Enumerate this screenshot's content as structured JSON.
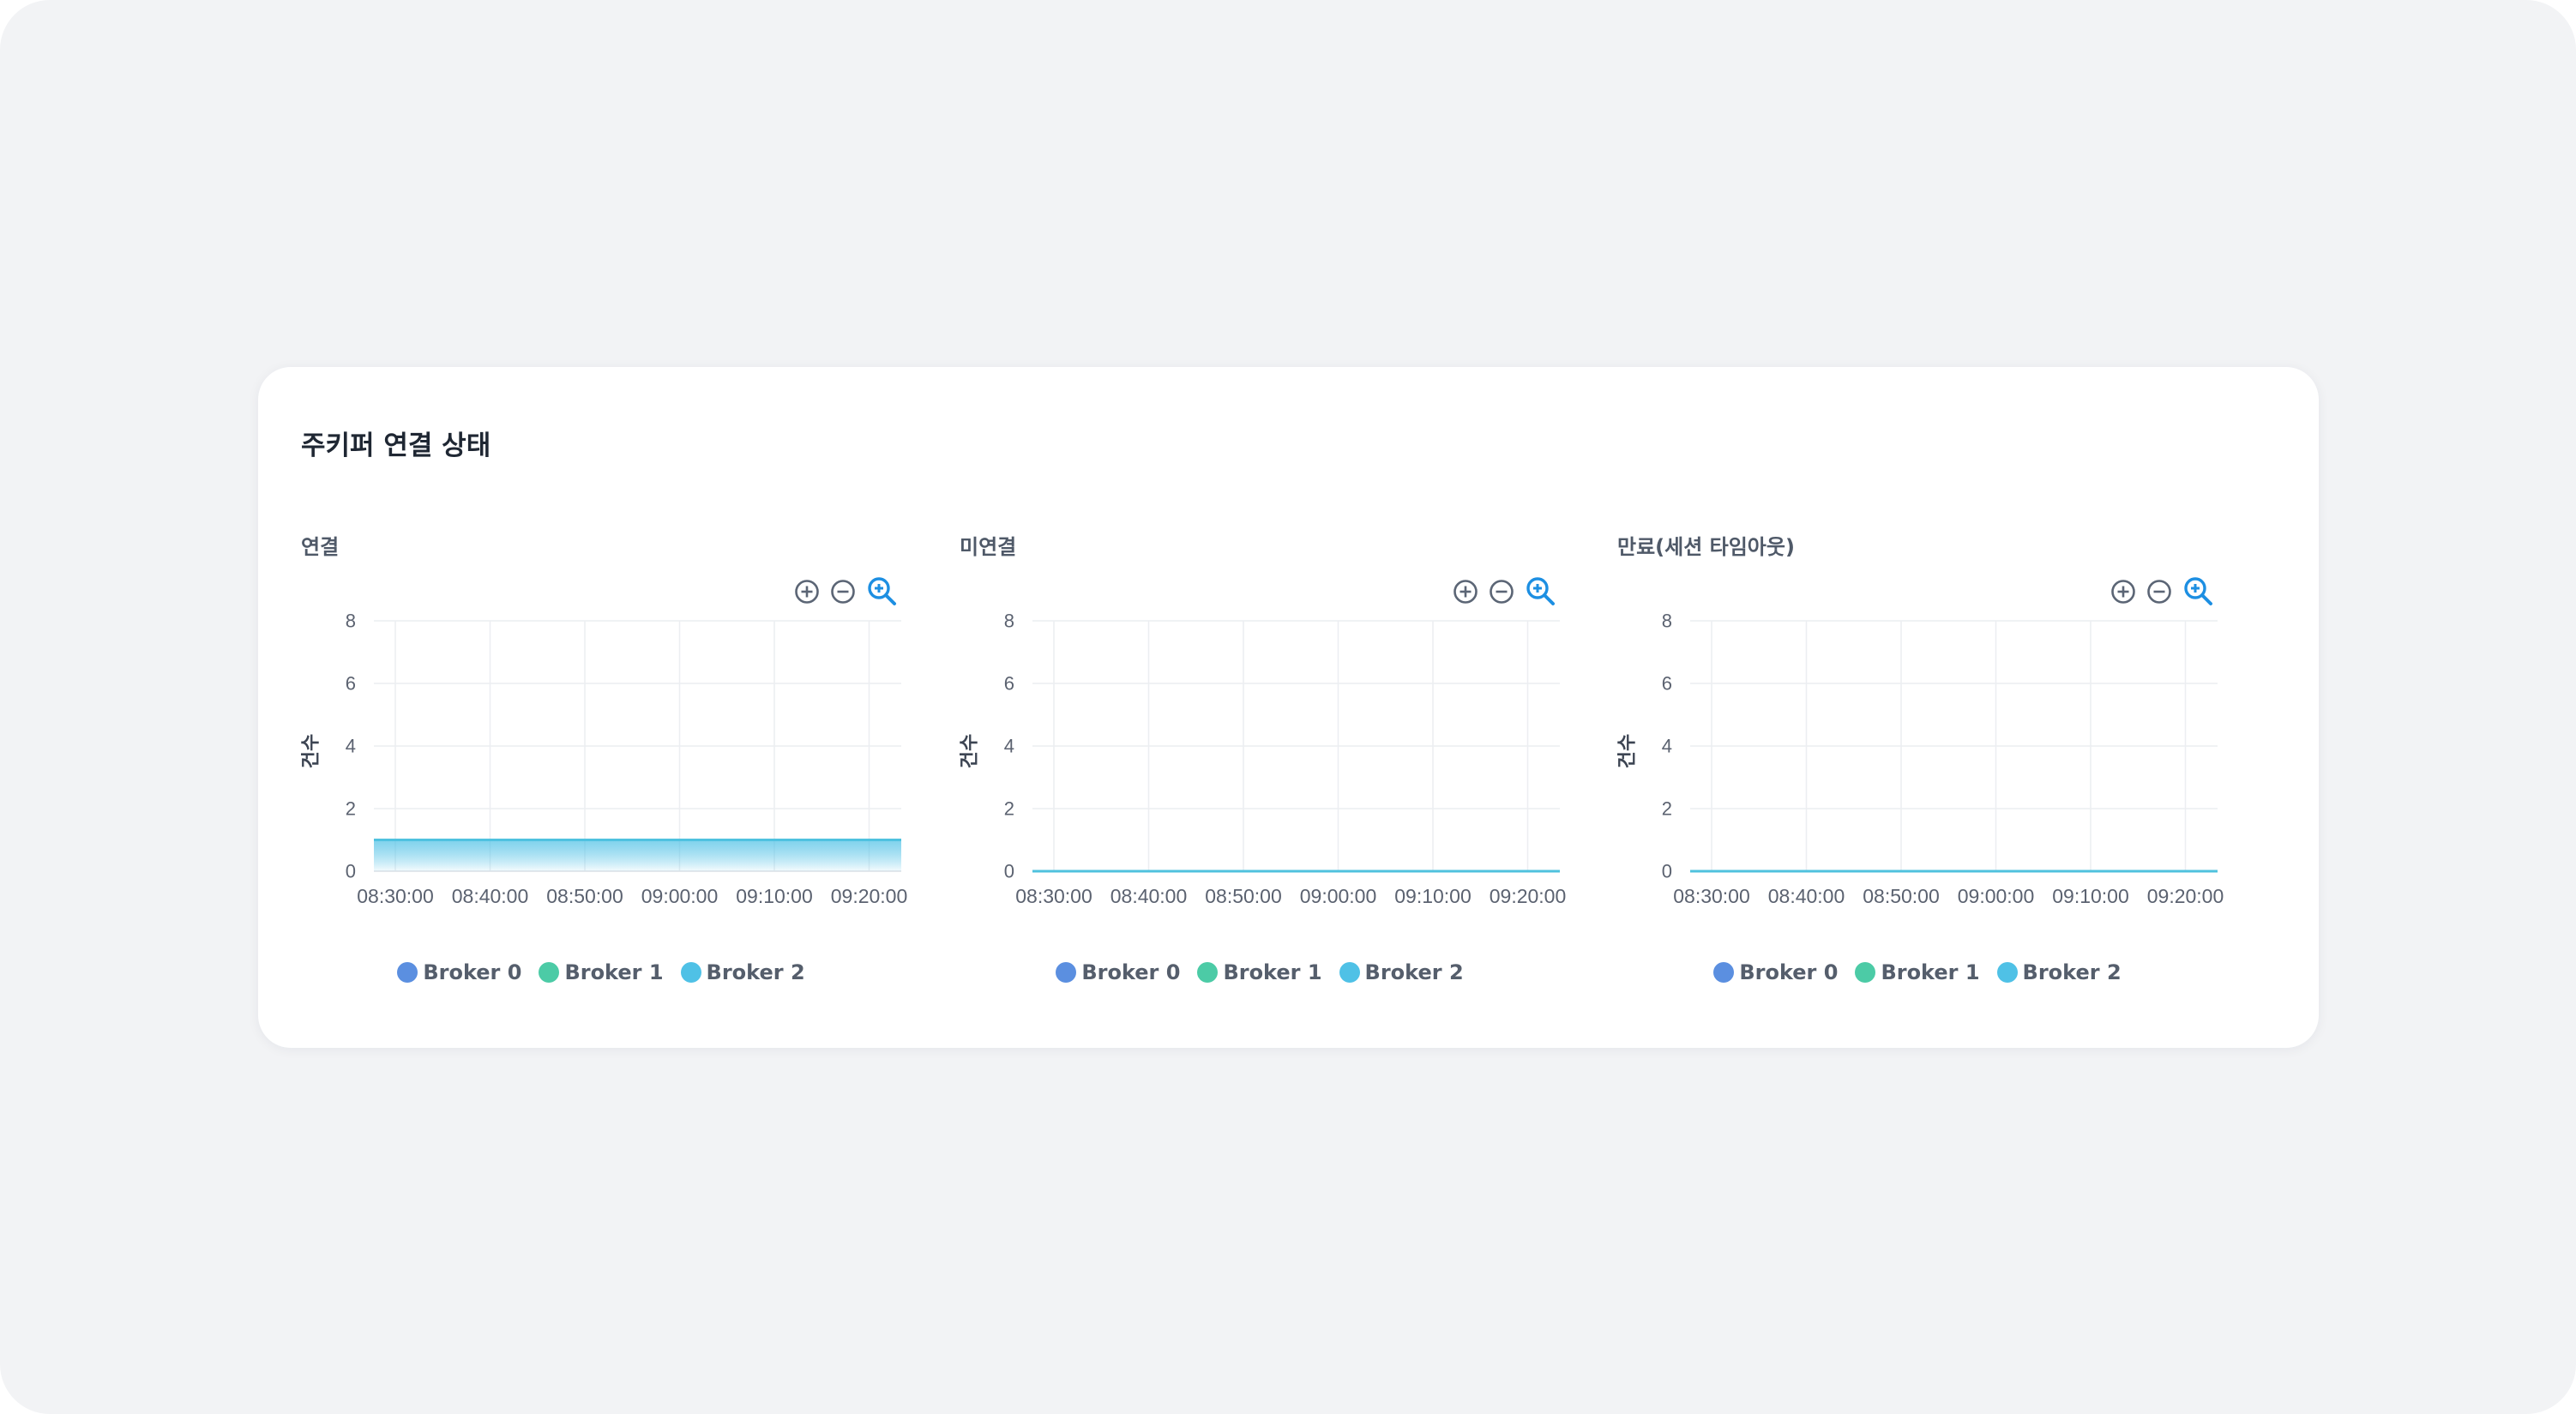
{
  "card": {
    "title": "주키퍼 연결 상태"
  },
  "colors": {
    "broker0": "#5b8fe0",
    "broker1": "#4ccba6",
    "broker2": "#4fc1e6",
    "grid": "#eceef1",
    "axisText": "#5b6270",
    "zoomIcon": "#1d8fe2",
    "toolIcon": "#5b6575"
  },
  "toolbar_icons": [
    "zoom-in-icon",
    "zoom-out-icon",
    "zoom-reset-icon"
  ],
  "chart_data": [
    {
      "type": "area",
      "title": "연결",
      "ylabel": "건수",
      "x": [
        "08:30:00",
        "08:40:00",
        "08:50:00",
        "09:00:00",
        "09:10:00",
        "09:20:00"
      ],
      "ylim": [
        0,
        8
      ],
      "yticks": [
        "0",
        "2",
        "4",
        "6",
        "8"
      ],
      "grid": true,
      "legend_position": "bottom",
      "series": [
        {
          "name": "Broker 0",
          "values": [
            1,
            1,
            1,
            1,
            1,
            1
          ]
        },
        {
          "name": "Broker 1",
          "values": [
            1,
            1,
            1,
            1,
            1,
            1
          ]
        },
        {
          "name": "Broker 2",
          "values": [
            1,
            1,
            1,
            1,
            1,
            1
          ]
        }
      ]
    },
    {
      "type": "area",
      "title": "미연결",
      "ylabel": "건수",
      "x": [
        "08:30:00",
        "08:40:00",
        "08:50:00",
        "09:00:00",
        "09:10:00",
        "09:20:00"
      ],
      "ylim": [
        0,
        8
      ],
      "yticks": [
        "0",
        "2",
        "4",
        "6",
        "8"
      ],
      "grid": true,
      "legend_position": "bottom",
      "series": [
        {
          "name": "Broker 0",
          "values": [
            0,
            0,
            0,
            0,
            0,
            0
          ]
        },
        {
          "name": "Broker 1",
          "values": [
            0,
            0,
            0,
            0,
            0,
            0
          ]
        },
        {
          "name": "Broker 2",
          "values": [
            0,
            0,
            0,
            0,
            0,
            0
          ]
        }
      ]
    },
    {
      "type": "area",
      "title": "만료(세션 타임아웃)",
      "ylabel": "건수",
      "x": [
        "08:30:00",
        "08:40:00",
        "08:50:00",
        "09:00:00",
        "09:10:00",
        "09:20:00"
      ],
      "ylim": [
        0,
        8
      ],
      "yticks": [
        "0",
        "2",
        "4",
        "6",
        "8"
      ],
      "grid": true,
      "legend_position": "bottom",
      "series": [
        {
          "name": "Broker 0",
          "values": [
            0,
            0,
            0,
            0,
            0,
            0
          ]
        },
        {
          "name": "Broker 1",
          "values": [
            0,
            0,
            0,
            0,
            0,
            0
          ]
        },
        {
          "name": "Broker 2",
          "values": [
            0,
            0,
            0,
            0,
            0,
            0
          ]
        }
      ]
    }
  ]
}
